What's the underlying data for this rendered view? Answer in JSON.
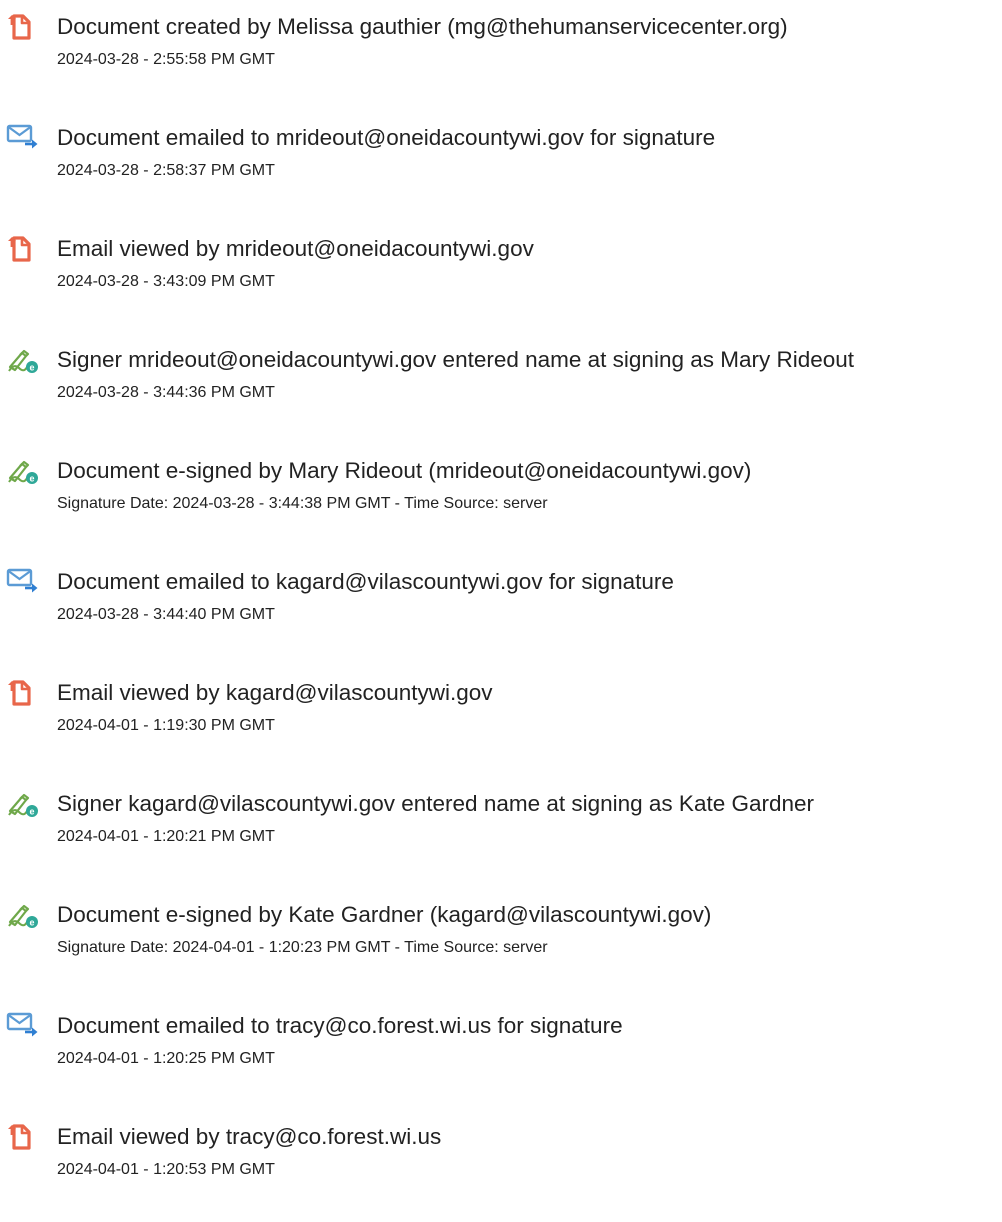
{
  "icon_colors": {
    "document": "#e8664a",
    "email": "#5b9bd5",
    "email_arrow": "#2f7fd2",
    "signature_pen": "#6fa84a",
    "signature_badge": "#2fa898"
  },
  "events": [
    {
      "icon": "document-icon",
      "description": "Document created by Melissa gauthier (mg@thehumanservicecenter.org)",
      "timestamp": "2024-03-28 - 2:55:58 PM GMT"
    },
    {
      "icon": "email-icon",
      "description": "Document emailed to mrideout@oneidacountywi.gov for signature",
      "timestamp": "2024-03-28 - 2:58:37 PM GMT"
    },
    {
      "icon": "document-icon",
      "description": "Email viewed by mrideout@oneidacountywi.gov",
      "timestamp": "2024-03-28 - 3:43:09 PM GMT"
    },
    {
      "icon": "signature-icon",
      "description": "Signer mrideout@oneidacountywi.gov entered name at signing as Mary Rideout",
      "timestamp": "2024-03-28 - 3:44:36 PM GMT"
    },
    {
      "icon": "signature-icon",
      "description": "Document e-signed by Mary Rideout (mrideout@oneidacountywi.gov)",
      "timestamp": "Signature Date: 2024-03-28 - 3:44:38 PM GMT - Time Source: server"
    },
    {
      "icon": "email-icon",
      "description": "Document emailed to kagard@vilascountywi.gov for signature",
      "timestamp": "2024-03-28 - 3:44:40 PM GMT"
    },
    {
      "icon": "document-icon",
      "description": "Email viewed by kagard@vilascountywi.gov",
      "timestamp": "2024-04-01 - 1:19:30 PM GMT"
    },
    {
      "icon": "signature-icon",
      "description": "Signer kagard@vilascountywi.gov entered name at signing as Kate Gardner",
      "timestamp": "2024-04-01 - 1:20:21 PM GMT"
    },
    {
      "icon": "signature-icon",
      "description": "Document e-signed by Kate Gardner (kagard@vilascountywi.gov)",
      "timestamp": "Signature Date: 2024-04-01 - 1:20:23 PM GMT - Time Source: server"
    },
    {
      "icon": "email-icon",
      "description": "Document emailed to tracy@co.forest.wi.us for signature",
      "timestamp": "2024-04-01 - 1:20:25 PM GMT"
    },
    {
      "icon": "document-icon",
      "description": "Email viewed by tracy@co.forest.wi.us",
      "timestamp": "2024-04-01 - 1:20:53 PM GMT"
    }
  ]
}
